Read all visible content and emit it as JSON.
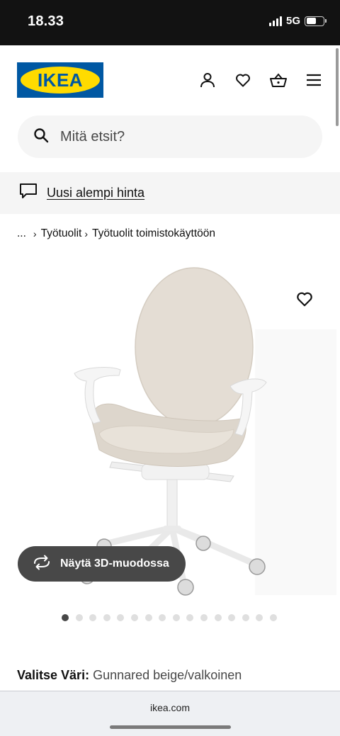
{
  "status_bar": {
    "time": "18.33",
    "network": "5G"
  },
  "header": {
    "logo_text": "IKEA",
    "icons": [
      "user-icon",
      "heart-icon",
      "basket-icon",
      "menu-icon"
    ]
  },
  "search": {
    "placeholder": "Mitä etsit?"
  },
  "banner": {
    "text": "Uusi alempi hinta"
  },
  "breadcrumb": {
    "ellipsis": "...",
    "items": [
      "Työtuolit",
      "Työtuolit toimistokäyttöön"
    ]
  },
  "product": {
    "view_3d_label": "Näytä 3D-muodossa",
    "image_count": 16,
    "active_image": 1
  },
  "color": {
    "label": "Valitse Väri:",
    "value": "Gunnared beige/valkoinen"
  },
  "browser": {
    "url": "ikea.com"
  },
  "colors": {
    "ikea_blue": "#0058a3",
    "ikea_yellow": "#ffdb00",
    "dark_button": "#484848",
    "light_bg": "#f5f5f5"
  }
}
